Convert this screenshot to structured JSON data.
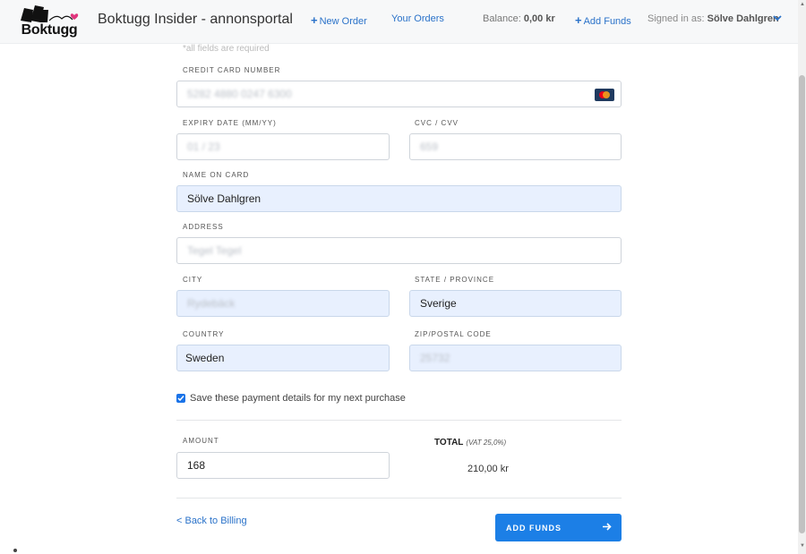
{
  "header": {
    "logo_text": "Boktugg",
    "title": "Boktugg Insider - annonsportal",
    "new_order": "New Order",
    "your_orders": "Your Orders",
    "balance_label": "Balance:",
    "balance_value": "0,00 kr",
    "add_funds": "Add Funds",
    "signed_in_label": "Signed in as:",
    "signed_in_user": "Sölve Dahlgren"
  },
  "form": {
    "required_hint": "*all fields are required",
    "card_number_label": "CREDIT CARD NUMBER",
    "card_number_value": "5282 4880 0247 6300",
    "expiry_label": "EXPIRY DATE (MM/YY)",
    "expiry_value": "01 / 23",
    "cvc_label": "CVC / CVV",
    "cvc_value": "659",
    "name_label": "NAME ON CARD",
    "name_value": "Sölve Dahlgren",
    "address_label": "ADDRESS",
    "address_value": "Tegel   Tegel",
    "city_label": "CITY",
    "city_value": "Rydebäck",
    "state_label": "STATE / PROVINCE",
    "state_value": "Sverige",
    "country_label": "COUNTRY",
    "country_value": "Sweden",
    "zip_label": "ZIP/POSTAL CODE",
    "zip_value": "25732",
    "save_details": "Save these payment details for my next purchase",
    "save_details_checked": true,
    "amount_label": "AMOUNT",
    "amount_value": "168",
    "total_label": "TOTAL",
    "total_vat": "(VAT 25,0%)",
    "total_value": "210,00 kr",
    "back_link": "< Back to Billing",
    "submit": "ADD FUNDS"
  },
  "colors": {
    "accent": "#1c7fe6",
    "link": "#2a72c9",
    "autofill": "#e8f0fe"
  }
}
